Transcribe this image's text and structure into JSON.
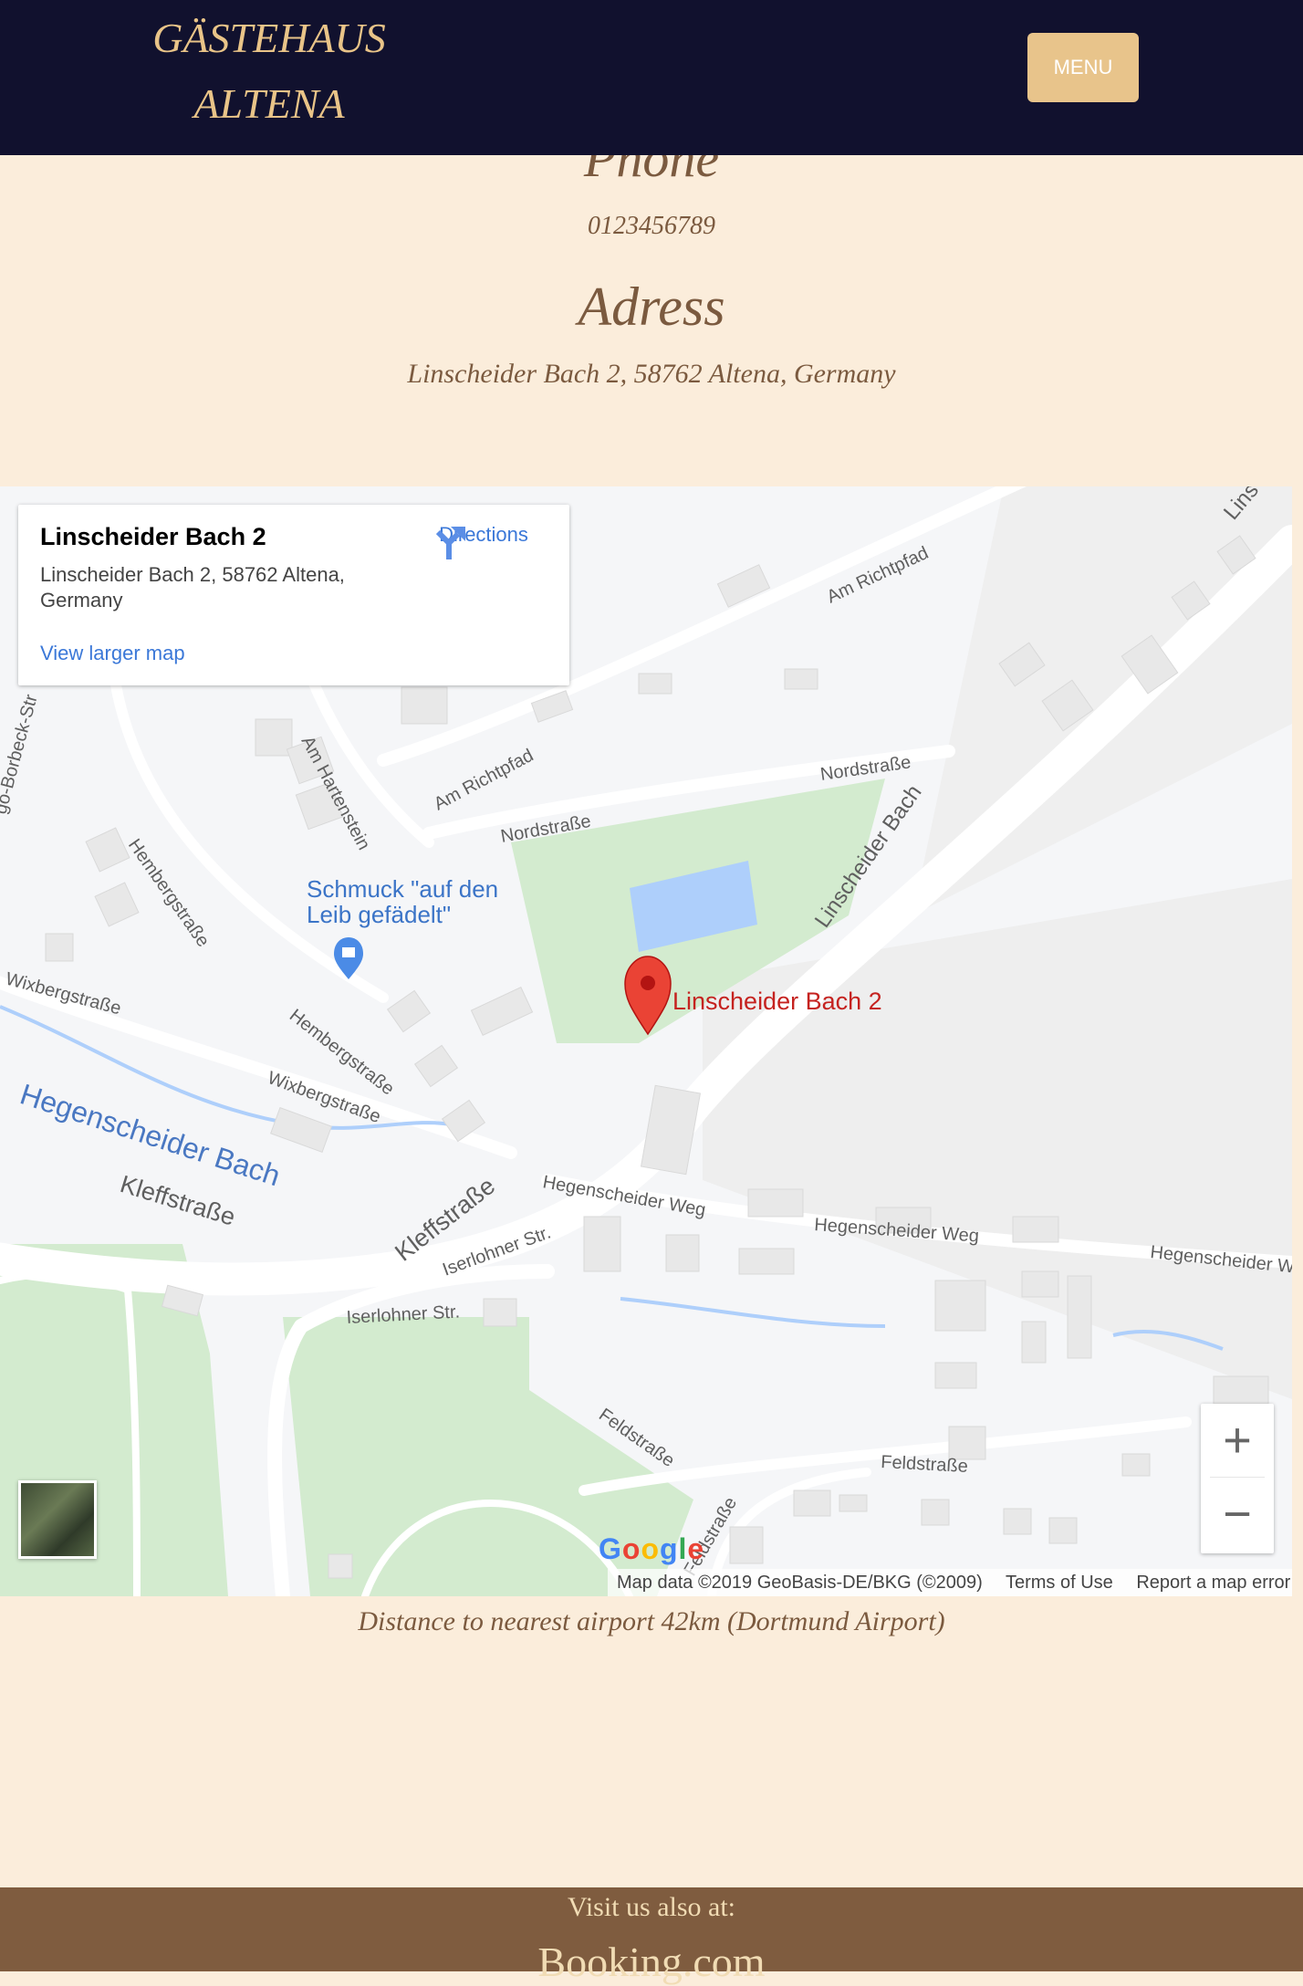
{
  "header": {
    "brand_line1": "GÄSTEHAUS",
    "brand_line2": "ALTENA",
    "menu_label": "MENU"
  },
  "contact": {
    "phone_heading": "Phone",
    "phone": "0123456789",
    "address_heading": "Adress",
    "address": "Linscheider Bach 2, 58762 Altena, Germany"
  },
  "map": {
    "place_card": {
      "title": "Linscheider Bach 2",
      "address": "Linscheider Bach 2, 58762 Altena, Germany",
      "directions_label": "Directions",
      "larger_map_label": "View larger map"
    },
    "marker_label": "Linscheider Bach 2",
    "poi_label": "Schmuck \"auf den Leib gefädelt\"",
    "street_labels": {
      "am_richtpfad": "Am Richtpfad",
      "nordstrasse": "Nordstraße",
      "linscheider_bach": "Linscheider Bach",
      "linscheider_partial": "Lins",
      "am_hartenstein": "Am Hartenstein",
      "hembergstrasse": "Hembergstraße",
      "wixbergstrasse": "Wixbergstraße",
      "hegenscheider_bach": "Hegenscheider Bach",
      "kleffstrasse": "Kleffstraße",
      "iserlohner_str": "Iserlohner Str.",
      "hegenscheider_weg": "Hegenscheider Weg",
      "hegenscheider_partial": "Hegenscheider W",
      "feldstrasse": "Feldstraße",
      "borbeck_partial": "go-Borbeck-Str"
    },
    "zoom_in": "+",
    "zoom_out": "−",
    "google_logo": "Google",
    "attribution": "Map data ©2019 GeoBasis-DE/BKG (©2009)",
    "terms": "Terms of Use",
    "report": "Report a map error",
    "colors": {
      "park": "#d3ebcf",
      "water": "#aecffb",
      "road": "#ffffff",
      "marker": "#ea4335"
    }
  },
  "distance_note": "Distance to nearest airport 42km (Dortmund Airport)",
  "footer": {
    "visit_label": "Visit us also at:",
    "booking_label": "Booking.com"
  }
}
